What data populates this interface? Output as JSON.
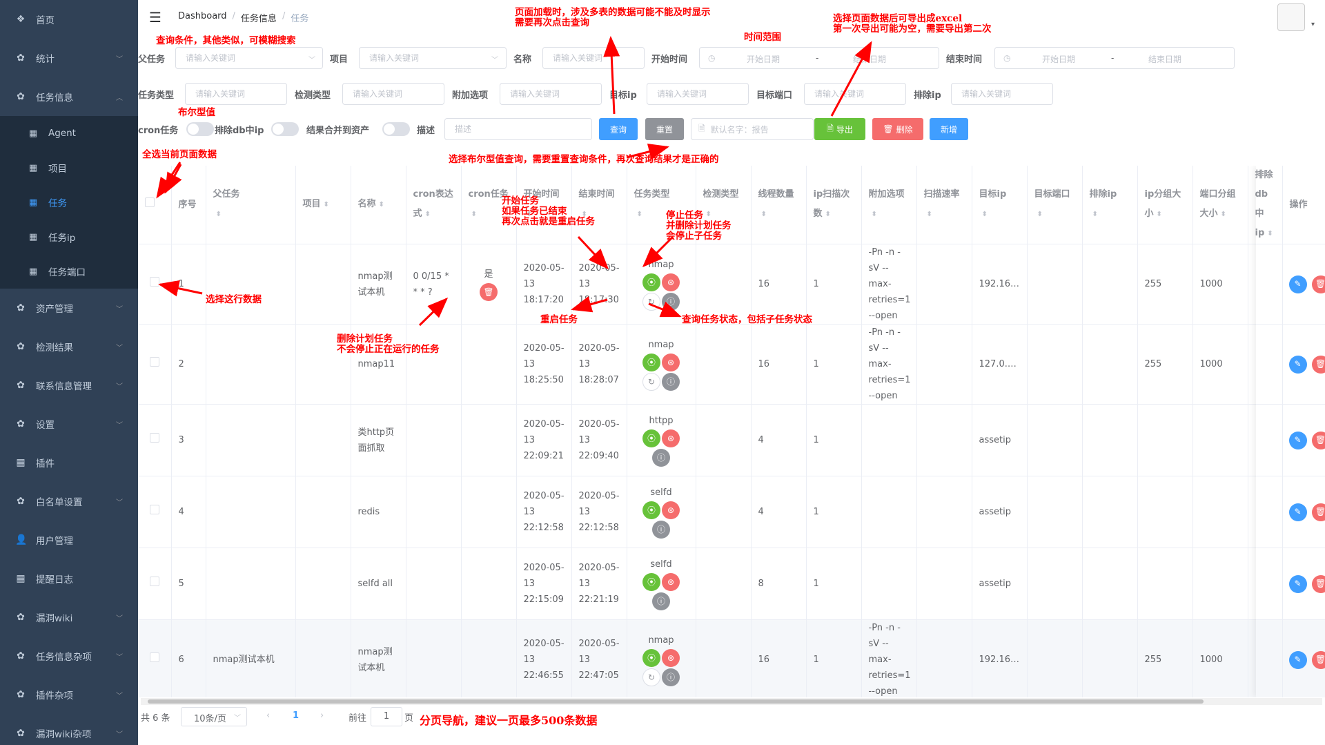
{
  "sidebar": {
    "items": [
      {
        "label": "首页",
        "icon": "dashboard-icon",
        "glyph": "❖"
      },
      {
        "label": "统计",
        "icon": "settings-icon",
        "glyph": "✿"
      },
      {
        "label": "任务信息",
        "icon": "settings-icon",
        "glyph": "✿"
      },
      {
        "label": "资产管理",
        "icon": "settings-icon",
        "glyph": "✿"
      },
      {
        "label": "检测结果",
        "icon": "settings-icon",
        "glyph": "✿"
      },
      {
        "label": "联系信息管理",
        "icon": "settings-icon",
        "glyph": "✿"
      },
      {
        "label": "设置",
        "icon": "settings-icon",
        "glyph": "✿"
      },
      {
        "label": "插件",
        "icon": "table-icon",
        "glyph": "▦"
      },
      {
        "label": "白名单设置",
        "icon": "settings-icon",
        "glyph": "✿"
      },
      {
        "label": "用户管理",
        "icon": "user-icon",
        "glyph": "👤"
      },
      {
        "label": "提醒日志",
        "icon": "table-icon",
        "glyph": "▦"
      },
      {
        "label": "漏洞wiki",
        "icon": "settings-icon",
        "glyph": "✿"
      },
      {
        "label": "任务信息杂项",
        "icon": "settings-icon",
        "glyph": "✿"
      },
      {
        "label": "插件杂项",
        "icon": "settings-icon",
        "glyph": "✿"
      },
      {
        "label": "漏洞wiki杂项",
        "icon": "settings-icon",
        "glyph": "✿"
      }
    ],
    "subitems": [
      "Agent",
      "项目",
      "任务",
      "任务ip",
      "任务端口"
    ]
  },
  "breadcrumb": {
    "l1": "Dashboard",
    "l2": "任务信息",
    "l3": "任务"
  },
  "filters": {
    "parent_task": "父任务",
    "project": "项目",
    "name": "名称",
    "start_time": "开始时间",
    "end_time": "结束时间",
    "task_type": "任务类型",
    "detect_type": "检测类型",
    "extra_opts": "附加选项",
    "target_ip": "目标ip",
    "target_port": "目标端口",
    "exclude_ip": "排除ip",
    "cron_task": "cron任务",
    "exclude_db": "排除db中ip",
    "merge": "结果合并到资产",
    "desc": "描述",
    "ph_keyword": "请输入关键词",
    "ph_start_date": "开始日期",
    "ph_end_date": "结束日期",
    "range_sep": "-",
    "ph_desc": "描述",
    "ph_export_name": "默认名字：报告"
  },
  "buttons": {
    "query": "查询",
    "reset": "重置",
    "export": "导出",
    "delete": "删除",
    "add": "新增"
  },
  "table": {
    "headers": {
      "seq": "序号",
      "parent": "父任务",
      "project": "项目",
      "name": "名称",
      "cron_expr": "cron表达式",
      "cron_task": "cron任务",
      "start": "开始时间",
      "end": "结束时间",
      "type": "任务类型",
      "detect": "检测类型",
      "threads": "线程数量",
      "ip_scan": "ip扫描次数",
      "extra": "附加选项",
      "rate": "扫描速率",
      "tip": "目标ip",
      "tport": "目标端口",
      "exip": "排除ip",
      "ipgroup": "ip分组大小",
      "portgroup": "端口分组大小",
      "exdb": "排除db中ip",
      "ops": "操作"
    },
    "rows": [
      {
        "seq": "1",
        "parent": "",
        "name": "nmap测试本机",
        "cron_expr": "0 0/15 * * * ?",
        "cron": "是",
        "start": "2020-05-13 18:17:20",
        "end": "2020-05-13 18:17:30",
        "type": "nmap",
        "threads": "16",
        "ipscan": "1",
        "extra": "-Pn -n -sV --max-retries=1 --open",
        "tip": "192.16…",
        "ipgroup": "255",
        "portgroup": "1000",
        "restart": true
      },
      {
        "seq": "2",
        "parent": "",
        "name": "nmap11",
        "cron_expr": "",
        "cron": "",
        "start": "2020-05-13 18:25:50",
        "end": "2020-05-13 18:28:07",
        "type": "nmap",
        "threads": "16",
        "ipscan": "1",
        "extra": "-Pn -n -sV --max-retries=1 --open",
        "tip": "127.0.…",
        "ipgroup": "255",
        "portgroup": "1000",
        "restart": true
      },
      {
        "seq": "3",
        "parent": "",
        "name": "类http页面抓取",
        "cron_expr": "",
        "cron": "",
        "start": "2020-05-13 22:09:21",
        "end": "2020-05-13 22:09:40",
        "type": "httpp",
        "threads": "4",
        "ipscan": "1",
        "extra": "",
        "tip": "assetip",
        "ipgroup": "",
        "portgroup": "",
        "restart": false
      },
      {
        "seq": "4",
        "parent": "",
        "name": "redis",
        "cron_expr": "",
        "cron": "",
        "start": "2020-05-13 22:12:58",
        "end": "2020-05-13 22:12:58",
        "type": "selfd",
        "threads": "4",
        "ipscan": "1",
        "extra": "",
        "tip": "assetip",
        "ipgroup": "",
        "portgroup": "",
        "restart": false
      },
      {
        "seq": "5",
        "parent": "",
        "name": "selfd all",
        "cron_expr": "",
        "cron": "",
        "start": "2020-05-13 22:15:09",
        "end": "2020-05-13 22:21:19",
        "type": "selfd",
        "threads": "8",
        "ipscan": "1",
        "extra": "",
        "tip": "assetip",
        "ipgroup": "",
        "portgroup": "",
        "restart": false
      },
      {
        "seq": "6",
        "parent": "nmap测试本机",
        "name": "nmap测试本机",
        "cron_expr": "",
        "cron": "",
        "start": "2020-05-13 22:46:55",
        "end": "2020-05-13 22:47:05",
        "type": "nmap",
        "threads": "16",
        "ipscan": "1",
        "extra": "-Pn -n -sV --max-retries=1 --open",
        "tip": "192.16…",
        "ipgroup": "255",
        "portgroup": "1000",
        "restart": true
      }
    ]
  },
  "pagination": {
    "total": "共 6 条",
    "page_size": "10条/页",
    "current": "1",
    "goto": "前往",
    "goto_value": "1",
    "page_unit": "页"
  },
  "annotations": {
    "query_cond": "查询条件，其他类似，可模糊搜索",
    "bool_val": "布尔型值",
    "select_all": "全选当前页面数据",
    "select_row": "选择这行数据",
    "page_load_1": "页面加载时，涉及多表的数据可能不能及时显示",
    "page_load_2": "需要再次点击查询",
    "time_range": "时间范围",
    "export_1": "选择页面数据后可导出成excel",
    "export_2": "第一次导出可能为空，需要导出第二次",
    "bool_query": "选择布尔型值查询，需要重置查询条件，再次查询结果才是正确的",
    "start_1": "开始任务",
    "start_2": "如果任务已结束",
    "start_3": "再次点击就是重启任务",
    "stop_1": "停止任务",
    "stop_2": "并删除计划任务",
    "stop_3": "会停止子任务",
    "restart": "重启任务",
    "status": "查询任务状态，包括子任务状态",
    "del_cron_1": "删除计划任务",
    "del_cron_2": "不会停止正在运行的任务",
    "pager": "分页导航，建议一页最多500条数据"
  },
  "colors": {
    "sidebar_bg": "#304156",
    "primary": "#409eff",
    "success": "#67c23a",
    "danger": "#f56c6c",
    "info": "#909399",
    "annotation": "#ff0000"
  }
}
